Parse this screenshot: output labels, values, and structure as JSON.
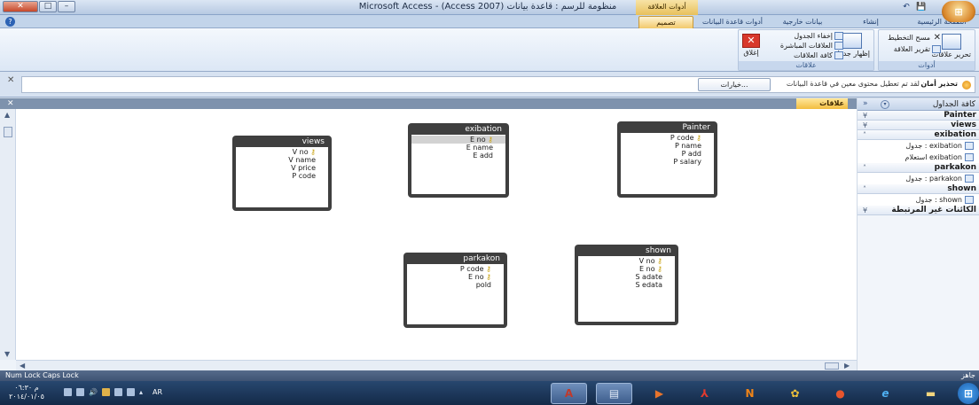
{
  "titlebar": {
    "title": "Microsoft Access - (Access 2007) منظومة للرسم : قاعدة بيانات",
    "context_tab": "أدوات العلاقة",
    "qat_save": "💾",
    "qat_undo": "↶"
  },
  "tabs": {
    "home": "الصفحة الرئيسية",
    "create": "إنشاء",
    "external": "بيانات خارجية",
    "dbtools": "أدوات قاعدة البيانات",
    "design": "تصميم"
  },
  "ribbon": {
    "tools_group": "أدوات",
    "edit_rel": "تحرير علاقات",
    "clear_layout": "مسح التخطيط",
    "rel_report": "تقرير العلاقة",
    "rel_group": "علاقات",
    "show_table": "إظهار جدول",
    "hide_table": "إخفاء الجدول",
    "direct_rel": "العلاقات المباشرة",
    "all_rel": "كافة العلاقات",
    "close": "إغلاق"
  },
  "msgbar": {
    "title": "تحذير أمان",
    "text": "لقد تم تعطيل محتوى معين في قاعدة البيانات",
    "options": "خيارات..."
  },
  "document": {
    "tab_label": "علاقات"
  },
  "tables": {
    "views": {
      "name": "views",
      "fields": [
        "V no",
        "V name",
        "V price",
        "P code"
      ],
      "keys": [
        true,
        false,
        false,
        false
      ]
    },
    "exibation": {
      "name": "exibation",
      "fields": [
        "E no",
        "E name",
        "E add"
      ],
      "keys": [
        true,
        false,
        false
      ]
    },
    "painter": {
      "name": "Painter",
      "fields": [
        "P code",
        "P name",
        "P add",
        "P salary"
      ],
      "keys": [
        true,
        false,
        false,
        false
      ]
    },
    "parkakon": {
      "name": "parkakon",
      "fields": [
        "P code",
        "E no",
        "pold"
      ],
      "keys": [
        true,
        true,
        false
      ]
    },
    "shown": {
      "name": "shown",
      "fields": [
        "V no",
        "E no",
        "S adate",
        "S edata"
      ],
      "keys": [
        true,
        true,
        false,
        false
      ]
    }
  },
  "nav": {
    "title": "كافة الجداول",
    "groups": {
      "painter": "Painter",
      "views": "views",
      "exibation": "exibation",
      "exibation_table": "exibation : جدول",
      "exibation_query": "exibation استعلام",
      "parkakon": "parkakon",
      "parkakon_table": "parkakon : جدول",
      "shown": "shown",
      "shown_table": "shown : جدول",
      "unrelated": "الكائنات غير المرتبطة"
    }
  },
  "status": {
    "left": "Num Lock    Caps Lock",
    "right": "جاهز"
  },
  "taskbar": {
    "time": "م ٠٦:٣٠",
    "date": "٢٠١٤/٠١/٠٥",
    "lang": "AR"
  },
  "colors": {
    "accent": "#f2c96b",
    "table_frame": "#3f3f3f",
    "key_icon": "#c9a416"
  }
}
